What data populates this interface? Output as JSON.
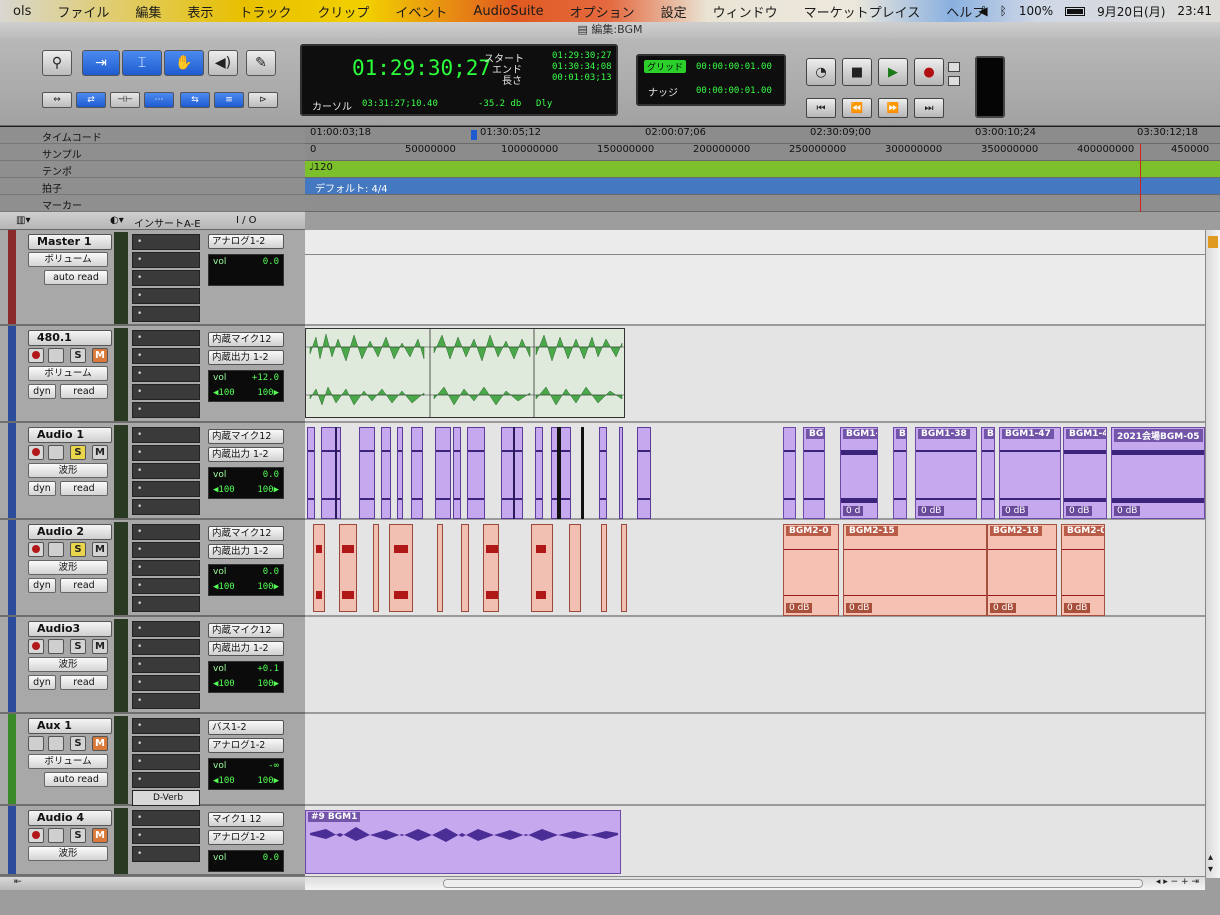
{
  "menubar": {
    "items": [
      "ols",
      "ファイル",
      "編集",
      "表示",
      "トラック",
      "クリップ",
      "イベント",
      "AudioSuite",
      "オプション",
      "設定",
      "ウィンドウ",
      "マーケットプレイス",
      "ヘルプ"
    ],
    "battery": "100%",
    "date": "9月20日(月)",
    "time": "23:41"
  },
  "window": {
    "title": "編集:BGM"
  },
  "counter": {
    "main": "01:29:30;27",
    "start_label": "スタート",
    "end_label": "エンド",
    "length_label": "長さ",
    "start": "01:29:30;27",
    "end": "01:30:34;08",
    "length": "00:01:03;13",
    "cursor_label": "カーソル",
    "cursor": "03:31:27;10.40",
    "level": "-35.2 db",
    "dly": "Dly"
  },
  "grid": {
    "grid_label": "グリッド",
    "grid_value": "00:00:00:01.00",
    "nudge_label": "ナッジ",
    "nudge_value": "00:00:00:01.00"
  },
  "rulers": {
    "labels": [
      "タイムコード",
      "サンプル",
      "テンポ",
      "拍子",
      "マーカー"
    ],
    "timecodes": [
      "01:00:03;18",
      "01:30:05;12",
      "02:00:07;06",
      "02:30:09;00",
      "03:00:10;24",
      "03:30:12;18"
    ],
    "samples": [
      "0",
      "50000000",
      "100000000",
      "150000000",
      "200000000",
      "250000000",
      "300000000",
      "350000000",
      "400000000",
      "450000"
    ],
    "tempo": "120",
    "meter": "デフォルト: 4/4"
  },
  "columns": {
    "inserts": "インサートA-E",
    "io": "I / O"
  },
  "tracks": [
    {
      "name": "Master 1",
      "view": "ボリューム",
      "auto": "auto read",
      "io1": "アナログ1-2",
      "vol": "0.0"
    },
    {
      "name": "480.1",
      "view": "ボリューム",
      "dyn": "dyn",
      "read": "read",
      "io1": "内蔵マイク12",
      "io2": "内蔵出力 1-2",
      "vol": "+12.0",
      "pan_l": "◀100",
      "pan_r": "100▶"
    },
    {
      "name": "Audio 1",
      "view": "波形",
      "dyn": "dyn",
      "read": "read",
      "io1": "内蔵マイク12",
      "io2": "内蔵出力 1-2",
      "vol": "0.0",
      "pan_l": "◀100",
      "pan_r": "100▶"
    },
    {
      "name": "Audio 2",
      "view": "波形",
      "dyn": "dyn",
      "read": "read",
      "io1": "内蔵マイク12",
      "io2": "内蔵出力 1-2",
      "vol": "0.0",
      "pan_l": "◀100",
      "pan_r": "100▶"
    },
    {
      "name": "Audio3",
      "view": "波形",
      "dyn": "dyn",
      "read": "read",
      "io1": "内蔵マイク12",
      "io2": "内蔵出力 1-2",
      "vol": "+0.1",
      "pan_l": "◀100",
      "pan_r": "100▶"
    },
    {
      "name": "Aux 1",
      "view": "ボリューム",
      "auto": "auto read",
      "io1": "バス1-2",
      "io2": "アナログ1-2",
      "vol": "-∞",
      "pan_l": "◀100",
      "pan_r": "100▶",
      "insert": "D-Verb"
    },
    {
      "name": "Audio 4",
      "view": "波形",
      "io1": "マイク1 12",
      "io2": "アナログ1-2",
      "vol": "0.0"
    }
  ],
  "clips": {
    "audio1": [
      "BG",
      "BGM1-",
      "B",
      "BGM1-38",
      "B",
      "BGM1-47",
      "BGM1-4",
      "2021会場BGM-05"
    ],
    "audio2": [
      "BGM2-0",
      "BGM2-15",
      "BGM2-18",
      "BGM2-0"
    ],
    "audio4": "#9 BGM1",
    "gain": "0 dB",
    "gain_short": "0 d"
  }
}
